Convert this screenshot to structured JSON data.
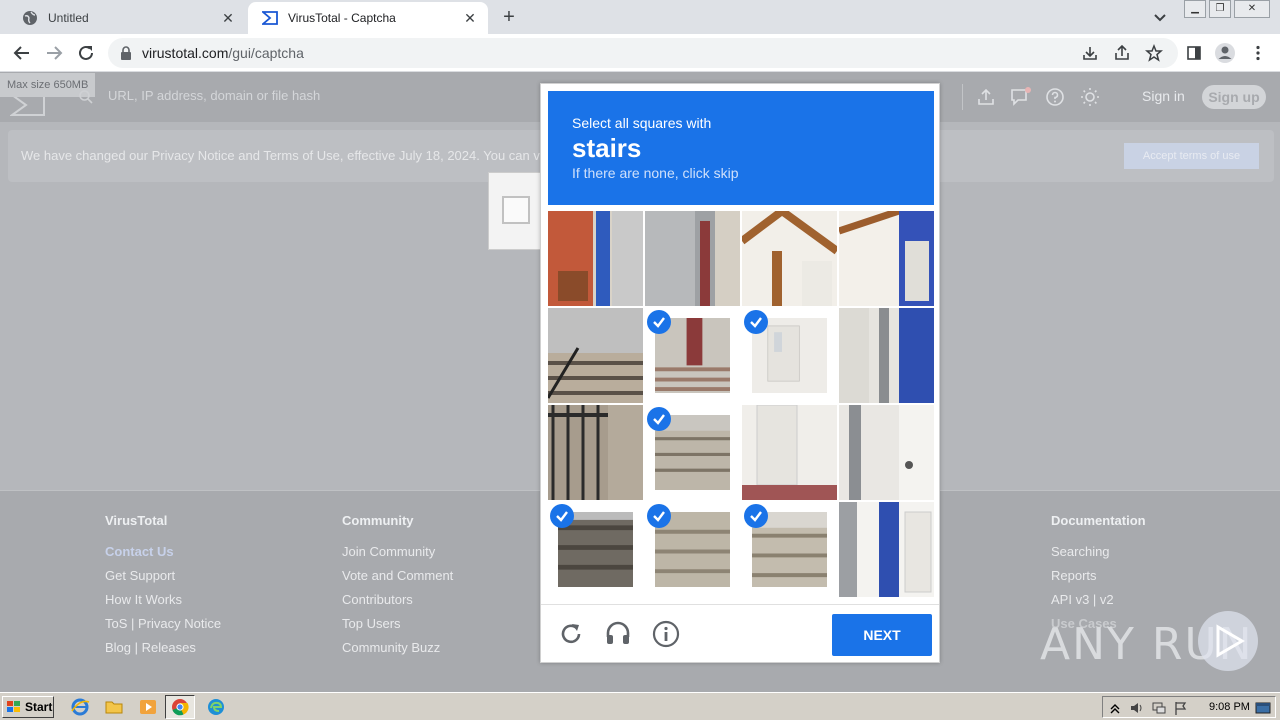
{
  "browser": {
    "tabs": [
      {
        "title": "Untitled",
        "icon": "globe-icon",
        "active": false
      },
      {
        "title": "VirusTotal - Captcha",
        "icon": "virustotal-icon",
        "active": true
      }
    ],
    "url_host": "virustotal.com",
    "url_path": "/gui/captcha"
  },
  "vt": {
    "max_size": "Max size 650MB",
    "search_placeholder": "URL, IP address, domain or file hash",
    "sign_in": "Sign in",
    "sign_up": "Sign up",
    "notice": "We have changed our Privacy Notice and Terms of Use, effective July 18, 2024. You can v",
    "accept": "Accept terms of use"
  },
  "captcha": {
    "prompt": "Select all squares with",
    "target": "stairs",
    "hint": "If there are none, click skip",
    "next": "NEXT",
    "selected": [
      5,
      6,
      9,
      12,
      13,
      14
    ]
  },
  "footer": {
    "col1": {
      "head": "VirusTotal",
      "links": [
        "Contact Us",
        "Get Support",
        "How It Works",
        "ToS | Privacy Notice",
        "Blog | Releases"
      ]
    },
    "col2": {
      "head": "Community",
      "links": [
        "Join Community",
        "Vote and Comment",
        "Contributors",
        "Top Users",
        "Community Buzz"
      ]
    },
    "col3": {
      "head": "Documentation",
      "links": [
        "Searching",
        "Reports",
        "API v3 | v2",
        "Use Cases"
      ]
    }
  },
  "watermark": "ANY RUN",
  "taskbar": {
    "start": "Start",
    "clock": "9:08 PM"
  },
  "colors": {
    "accent": "#1a73e8"
  }
}
